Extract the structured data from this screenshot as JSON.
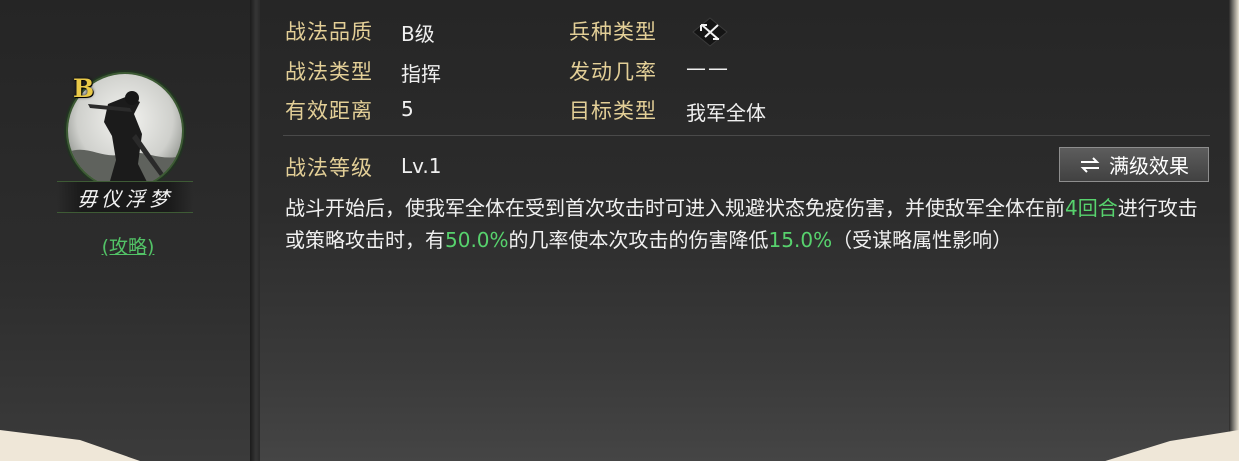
{
  "hero": {
    "grade": "B",
    "name": "毋仪浮梦",
    "strategy_link": "(攻略)"
  },
  "attributes": {
    "quality_label": "战法品质",
    "quality_value": "B级",
    "unit_type_label": "兵种类型",
    "unit_type_icon": "crossed-bow-icon",
    "type_label": "战法类型",
    "type_value": "指挥",
    "trigger_rate_label": "发动几率",
    "trigger_rate_value": "——",
    "range_label": "有效距离",
    "range_value": "5",
    "target_label": "目标类型",
    "target_value": "我军全体"
  },
  "level": {
    "label": "战法等级",
    "value": "Lv.1",
    "max_button_label": "满级效果"
  },
  "description": {
    "p1": "战斗开始后，使我军全体在受到首次攻击时可进入规避状态免疫伤害，并使敌军全体在前",
    "rounds": "4回合",
    "p2": "进行攻击或策略攻击时，有",
    "chance": "50.0%",
    "p3": "的几率使本次攻击的伤害降低",
    "reduction": "15.0%",
    "p4": "（受谋略属性影响）"
  },
  "colors": {
    "label_gold": "#e3cf97",
    "highlight_green": "#57d26d",
    "grade_yellow": "#e9c948"
  }
}
